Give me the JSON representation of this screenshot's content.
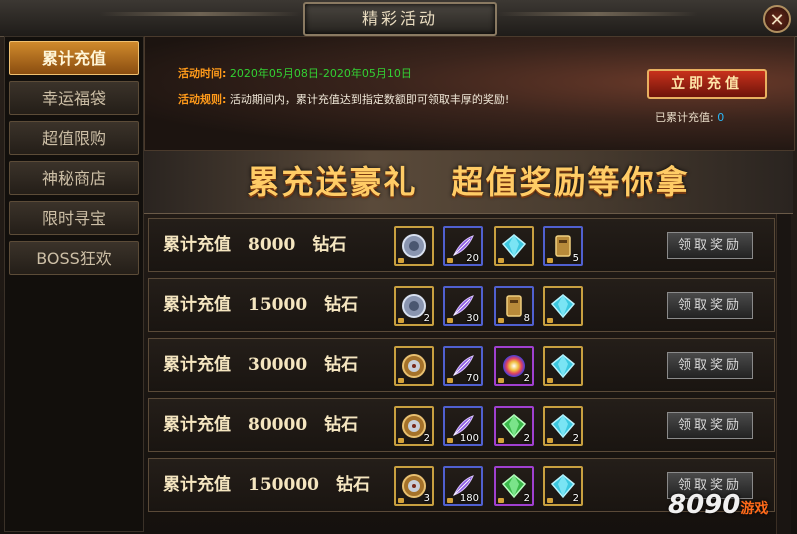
{
  "window": {
    "title": "精彩活动"
  },
  "sidebar": {
    "items": [
      {
        "label": "累计充值",
        "active": true
      },
      {
        "label": "幸运福袋",
        "active": false
      },
      {
        "label": "超值限购",
        "active": false
      },
      {
        "label": "神秘商店",
        "active": false
      },
      {
        "label": "限时寻宝",
        "active": false
      },
      {
        "label": "BOSS狂欢",
        "active": false
      }
    ]
  },
  "header": {
    "time_label": "活动时间:",
    "time_value": "2020年05月08日-2020年05月10日",
    "rule_label": "活动规则:",
    "rule_value": "活动期间内，累计充值达到指定数额即可领取丰厚的奖励!",
    "charge_button": "立即充值",
    "total_label": "已累计充值:",
    "total_value": "0"
  },
  "slogan": "累充送豪礼　超值奖励等你拿",
  "rows": [
    {
      "label": "累计充值　8000　钻石",
      "button": "领取奖励",
      "items": [
        {
          "icon": "silver-medal-icon",
          "count": ""
        },
        {
          "icon": "purple-feather-icon",
          "count": "20"
        },
        {
          "icon": "cyan-gem-icon",
          "count": ""
        },
        {
          "icon": "gold-token-icon",
          "count": "5"
        }
      ]
    },
    {
      "label": "累计充值　15000　钻石",
      "button": "领取奖励",
      "items": [
        {
          "icon": "silver-medal-icon",
          "count": "2"
        },
        {
          "icon": "purple-feather-icon",
          "count": "30"
        },
        {
          "icon": "gold-token-icon",
          "count": "8"
        },
        {
          "icon": "cyan-gem-icon",
          "count": ""
        }
      ]
    },
    {
      "label": "累计充值　30000　钻石",
      "button": "领取奖励",
      "items": [
        {
          "icon": "gold-medal-icon",
          "count": ""
        },
        {
          "icon": "purple-feather-icon",
          "count": "70"
        },
        {
          "icon": "rainbow-orb-icon",
          "count": "2"
        },
        {
          "icon": "cyan-gem-icon",
          "count": ""
        }
      ]
    },
    {
      "label": "累计充值　80000　钻石",
      "button": "领取奖励",
      "items": [
        {
          "icon": "gold-medal-icon",
          "count": "2"
        },
        {
          "icon": "purple-feather-icon",
          "count": "100"
        },
        {
          "icon": "green-gem-icon",
          "count": "2"
        },
        {
          "icon": "cyan-gem-icon",
          "count": "2"
        }
      ]
    },
    {
      "label": "累计充值　150000　钻石",
      "button": "领取奖励",
      "items": [
        {
          "icon": "gold-medal-icon",
          "count": "3"
        },
        {
          "icon": "purple-feather-icon",
          "count": "180"
        },
        {
          "icon": "green-gem-icon",
          "count": "2"
        },
        {
          "icon": "cyan-gem-icon",
          "count": "2"
        }
      ]
    }
  ],
  "watermark": {
    "brand": "8090",
    "suffix": "游戏"
  },
  "colors": {
    "accent": "#d08a2c",
    "time_value": "#33d033",
    "label": "#ff9a1a",
    "total_value": "#29b6f6"
  }
}
